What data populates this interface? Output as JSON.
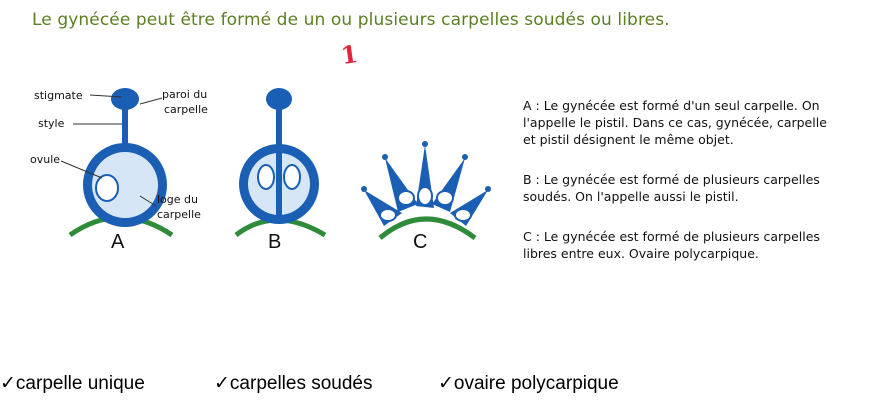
{
  "title": "Le gynécée peut être formé de un ou plusieurs carpelles soudés ou libres.",
  "mark": "1",
  "labels": {
    "stigmate": "stigmate",
    "style": "style",
    "paroi_line1": "paroi du",
    "paroi_line2": "carpelle",
    "ovule": "ovule",
    "loge_line1": "loge du",
    "loge_line2": "carpelle"
  },
  "figures": [
    "A",
    "B",
    "C"
  ],
  "descriptions": [
    [
      "A : Le gynécée est formé d'un seul carpelle. On",
      "l'appelle le pistil. Dans ce cas, gynécée, carpelle",
      "et pistil désignent le même objet."
    ],
    [
      "B : Le gynécée est formé de plusieurs carpelles",
      "soudés. On l'appelle aussi le pistil."
    ],
    [
      "C : Le gynécée est formé de plusieurs carpelles",
      "libres entre eux. Ovaire polycarpique."
    ]
  ],
  "checks": [
    "✓carpelle unique",
    "✓carpelles soudés",
    "✓ovaire polycarpique"
  ],
  "colors": {
    "carpel": "#1a5fb4",
    "loge": "#d6e6f7",
    "receptacle": "#2e8b3a",
    "title": "#5b7f22"
  }
}
